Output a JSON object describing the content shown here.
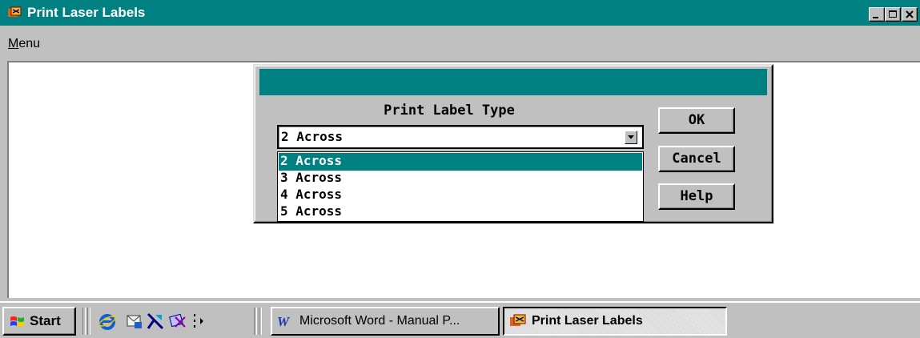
{
  "window": {
    "title": "Print Laser Labels",
    "title_bar_color": "#008080",
    "icon": "print-labels-app-icon"
  },
  "menubar": {
    "menu_prefix": "M",
    "menu_rest": "enu"
  },
  "dialog": {
    "heading": "Print Label Type",
    "combo_value": "2 Across",
    "options": [
      "2 Across",
      "3 Across",
      "4 Across",
      "5 Across"
    ],
    "selected_index": 0,
    "buttons": {
      "ok": "OK",
      "cancel": "Cancel",
      "help": "Help"
    }
  },
  "taskbar": {
    "start_label": "Start",
    "quick_launch_icons": [
      "internet-explorer-icon",
      "outlook-express-icon",
      "channels-icon",
      "desktop-icon",
      "more-arrow-icon"
    ],
    "tasks": [
      {
        "label": "Microsoft Word - Manual P...",
        "icon": "word-icon",
        "active": false
      },
      {
        "label": "Print Laser Labels",
        "icon": "print-labels-app-icon",
        "active": true
      }
    ]
  }
}
